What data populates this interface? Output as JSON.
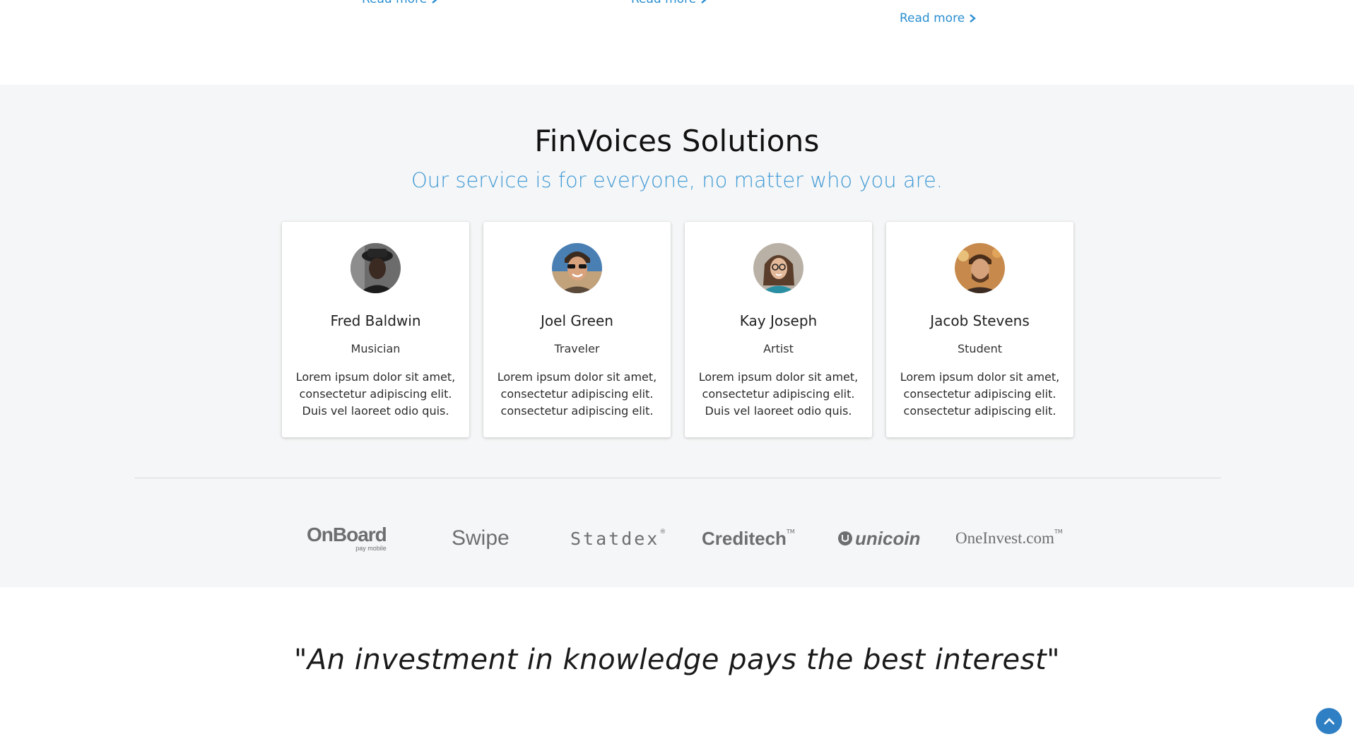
{
  "top": {
    "read_more_label": "Read more"
  },
  "solutions": {
    "title": "FinVoices Solutions",
    "subtitle": "Our service is for everyone, no matter who you are.",
    "cards": [
      {
        "name": "Fred Baldwin",
        "role": "Musician",
        "desc": "Lorem ipsum dolor sit amet, consectetur adipiscing elit. Duis vel laoreet odio quis."
      },
      {
        "name": "Joel Green",
        "role": "Traveler",
        "desc": "Lorem ipsum dolor sit amet, consectetur adipiscing elit. consectetur adipiscing elit."
      },
      {
        "name": "Kay Joseph",
        "role": "Artist",
        "desc": "Lorem ipsum dolor sit amet, consectetur adipiscing elit. Duis vel laoreet odio quis."
      },
      {
        "name": "Jacob Stevens",
        "role": "Student",
        "desc": "Lorem ipsum dolor sit amet, consectetur adipiscing elit. consectetur adipiscing elit."
      }
    ],
    "logos": {
      "onboard_main": "OnBoard",
      "onboard_sub": "pay mobile",
      "swipe": "Swipe",
      "statdex": "Statdex",
      "creditech": "Creditech",
      "unicoin": "unicoin",
      "oneinvest": "OneInvest.com"
    }
  },
  "quote": {
    "text": "\"An investment in knowledge pays the best interest\""
  },
  "colors": {
    "accent": "#3f9ad6",
    "link": "#2a8fd1",
    "section_bg": "#f5f6f7",
    "back_to_top": "#2f7fc4"
  },
  "icons": {
    "read_more": "chevron-right-icon",
    "back_to_top": "chevron-up-icon"
  }
}
